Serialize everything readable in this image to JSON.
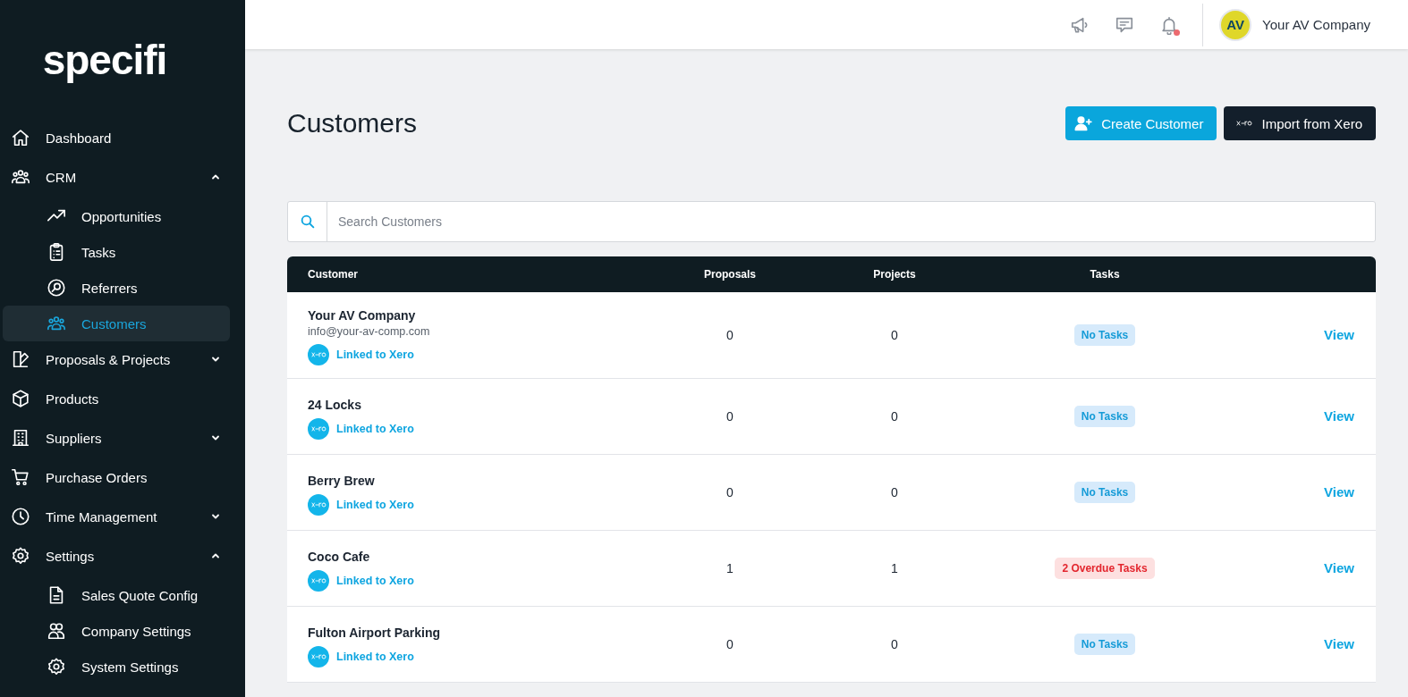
{
  "logo": "specifi",
  "sidebar": {
    "items": [
      {
        "label": "Dashboard",
        "selected": false
      },
      {
        "label": "CRM",
        "selected": false,
        "expanded": true,
        "children": [
          {
            "label": "Opportunities",
            "selected": false
          },
          {
            "label": "Tasks",
            "selected": false
          },
          {
            "label": "Referrers",
            "selected": false
          },
          {
            "label": "Customers",
            "selected": true
          }
        ]
      },
      {
        "label": "Proposals & Projects",
        "selected": false,
        "expanded": false
      },
      {
        "label": "Products",
        "selected": false
      },
      {
        "label": "Suppliers",
        "selected": false,
        "expanded": false
      },
      {
        "label": "Purchase Orders",
        "selected": false
      },
      {
        "label": "Time Management",
        "selected": false,
        "expanded": false
      },
      {
        "label": "Settings",
        "selected": false,
        "expanded": true,
        "children": [
          {
            "label": "Sales Quote Config",
            "selected": false
          },
          {
            "label": "Company Settings",
            "selected": false
          },
          {
            "label": "System Settings",
            "selected": false
          }
        ]
      }
    ]
  },
  "topbar": {
    "notifications_unread": true,
    "avatar_initials": "AV",
    "company": "Your AV Company"
  },
  "page": {
    "title": "Customers",
    "buttons": [
      {
        "kind": "create",
        "label": "Create Customer"
      },
      {
        "kind": "import",
        "label": "Import from Xero"
      }
    ]
  },
  "search": {
    "placeholder": "Search Customers"
  },
  "table": {
    "columns": [
      "Customer",
      "Proposals",
      "Projects",
      "Tasks"
    ],
    "rows": [
      {
        "name": "Your AV Company",
        "email": "info@your-av-comp.com",
        "link": "Linked to Xero",
        "proposals": "0",
        "projects": "0",
        "tasks": {
          "kind": "none",
          "label": "No Tasks"
        },
        "action": "View"
      },
      {
        "name": "24 Locks",
        "link": "Linked to Xero",
        "proposals": "0",
        "projects": "0",
        "tasks": {
          "kind": "none",
          "label": "No Tasks"
        },
        "action": "View"
      },
      {
        "name": "Berry Brew",
        "link": "Linked to Xero",
        "proposals": "0",
        "projects": "0",
        "tasks": {
          "kind": "none",
          "label": "No Tasks"
        },
        "action": "View"
      },
      {
        "name": "Coco Cafe",
        "link": "Linked to Xero",
        "proposals": "1",
        "projects": "1",
        "tasks": {
          "kind": "overdue",
          "label": "2 Overdue Tasks"
        },
        "action": "View"
      },
      {
        "name": "Fulton Airport Parking",
        "link": "Linked to Xero",
        "proposals": "0",
        "projects": "0",
        "tasks": {
          "kind": "none",
          "label": "No Tasks"
        },
        "action": "View"
      }
    ]
  }
}
